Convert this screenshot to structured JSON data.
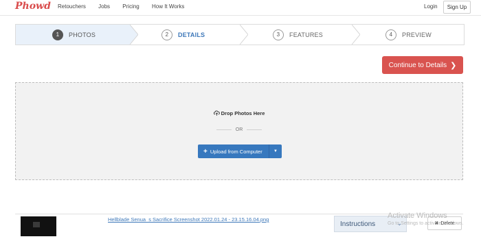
{
  "nav": {
    "logo": "Phowd",
    "links": [
      "Retouchers",
      "Jobs",
      "Pricing",
      "How It Works"
    ],
    "login": "Login",
    "signup": "Sign Up"
  },
  "steps": [
    {
      "num": "1",
      "label": "PHOTOS",
      "state": "active"
    },
    {
      "num": "2",
      "label": "DETAILS",
      "state": "next"
    },
    {
      "num": "3",
      "label": "FEATURES",
      "state": "upcoming"
    },
    {
      "num": "4",
      "label": "PREVIEW",
      "state": "upcoming"
    }
  ],
  "continue_label": "Continue to Details",
  "continue_icon": "chevron-right-icon",
  "dropzone": {
    "title": "Drop Photos Here",
    "title_icon": "upload-cloud-icon",
    "or": "OR",
    "upload_label": "Upload from Computer",
    "upload_icon": "plus-icon"
  },
  "file": {
    "name": "Hellblade Senua_s Sacrifice Screenshot 2022.01.24 - 23.15.16.04.png",
    "instructions": "Instructions",
    "delete": "Delete"
  },
  "watermark": {
    "line1": "Activate Windows",
    "line2": "Go to Settings to activate Windows."
  },
  "colors": {
    "brand": "#d94c4c",
    "primary": "#3778be",
    "danger": "#d9534f",
    "active_step_bg": "#e9f1fa"
  }
}
